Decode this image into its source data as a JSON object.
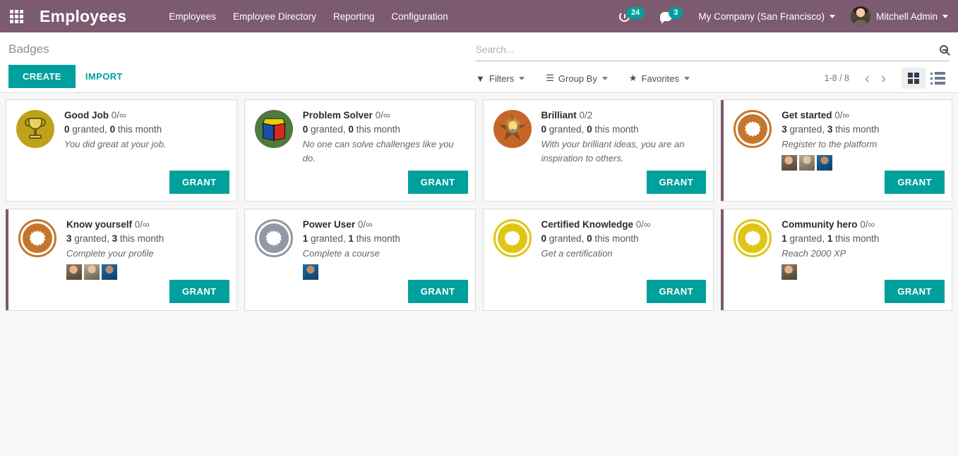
{
  "navbar": {
    "apps_icon": "apps-grid-icon",
    "brand": "Employees",
    "menu": [
      {
        "label": "Employees"
      },
      {
        "label": "Employee Directory"
      },
      {
        "label": "Reporting"
      },
      {
        "label": "Configuration"
      }
    ],
    "activity_icon": "activity-clock-icon",
    "activity_count": "24",
    "messages_icon": "chat-bubble-icon",
    "messages_count": "3",
    "company": "My Company (San Francisco)",
    "user": "Mitchell Admin"
  },
  "control_panel": {
    "breadcrumb": "Badges",
    "create_label": "CREATE",
    "import_label": "IMPORT",
    "search": {
      "placeholder": "Search...",
      "value": "",
      "icon": "magnifier-minus-icon"
    },
    "filters_label": "Filters",
    "filters_icon": "funnel-icon",
    "group_by_label": "Group By",
    "group_by_icon": "hamburger-lines-icon",
    "favorites_label": "Favorites",
    "favorites_icon": "star-icon",
    "pager": "1-8 / 8",
    "prev_icon": "chevron-left-icon",
    "next_icon": "chevron-right-icon",
    "prev_label": "‹",
    "next_label": "›",
    "view_kanban_icon": "kanban-view-icon",
    "view_list_icon": "list-view-icon"
  },
  "colors": {
    "brand_purple": "#7C5A6F",
    "accent_teal": "#00A09D",
    "page_bg": "#f7f7f7",
    "card_border": "#d5dce0"
  },
  "grant_label": "GRANT",
  "badges": [
    {
      "name": "Good Job",
      "ratio": "0/∞",
      "granted_count": "0",
      "granted_word": "granted,",
      "month_count": "0",
      "month_word": "this month",
      "description": "You did great at your job.",
      "icon": "trophy-badge-icon",
      "accent": false,
      "avatars": []
    },
    {
      "name": "Problem Solver",
      "ratio": "0/∞",
      "granted_count": "0",
      "granted_word": "granted,",
      "month_count": "0",
      "month_word": "this month",
      "description": "No one can solve challenges like you do.",
      "icon": "rubiks-cube-badge-icon",
      "accent": false,
      "avatars": []
    },
    {
      "name": "Brilliant",
      "ratio": "0/2",
      "granted_count": "0",
      "granted_word": "granted,",
      "month_count": "0",
      "month_word": "this month",
      "description": "With your brilliant ideas, you are an inspiration to others.",
      "icon": "star-lightbulb-badge-icon",
      "accent": false,
      "avatars": []
    },
    {
      "name": "Get started",
      "ratio": "0/∞",
      "granted_count": "3",
      "granted_word": "granted,",
      "month_count": "3",
      "month_word": "this month",
      "description": "Register to the platform",
      "icon": "starburst-badge-icon",
      "badge_color": "#C4772C",
      "accent": true,
      "avatars": [
        "a1",
        "a2",
        "a3"
      ]
    },
    {
      "name": "Know yourself",
      "ratio": "0/∞",
      "granted_count": "3",
      "granted_word": "granted,",
      "month_count": "3",
      "month_word": "this month",
      "description": "Complete your profile",
      "icon": "starburst-badge-icon",
      "badge_color": "#C4772C",
      "accent": true,
      "avatars": [
        "a1",
        "a2",
        "a3"
      ]
    },
    {
      "name": "Power User",
      "ratio": "0/∞",
      "granted_count": "1",
      "granted_word": "granted,",
      "month_count": "1",
      "month_word": "this month",
      "description": "Complete a course",
      "icon": "starburst-badge-icon",
      "badge_color": "#9199A4",
      "accent": false,
      "avatars": [
        "a3"
      ]
    },
    {
      "name": "Certified Knowledge",
      "ratio": "0/∞",
      "granted_count": "0",
      "granted_word": "granted,",
      "month_count": "0",
      "month_word": "this month",
      "description": "Get a certification",
      "icon": "starburst-badge-icon",
      "badge_color": "#E0C512",
      "accent": false,
      "avatars": []
    },
    {
      "name": "Community hero",
      "ratio": "0/∞",
      "granted_count": "1",
      "granted_word": "granted,",
      "month_count": "1",
      "month_word": "this month",
      "description": "Reach 2000 XP",
      "icon": "starburst-badge-icon",
      "badge_color": "#E0C512",
      "accent": true,
      "avatars": [
        "a1"
      ]
    }
  ]
}
